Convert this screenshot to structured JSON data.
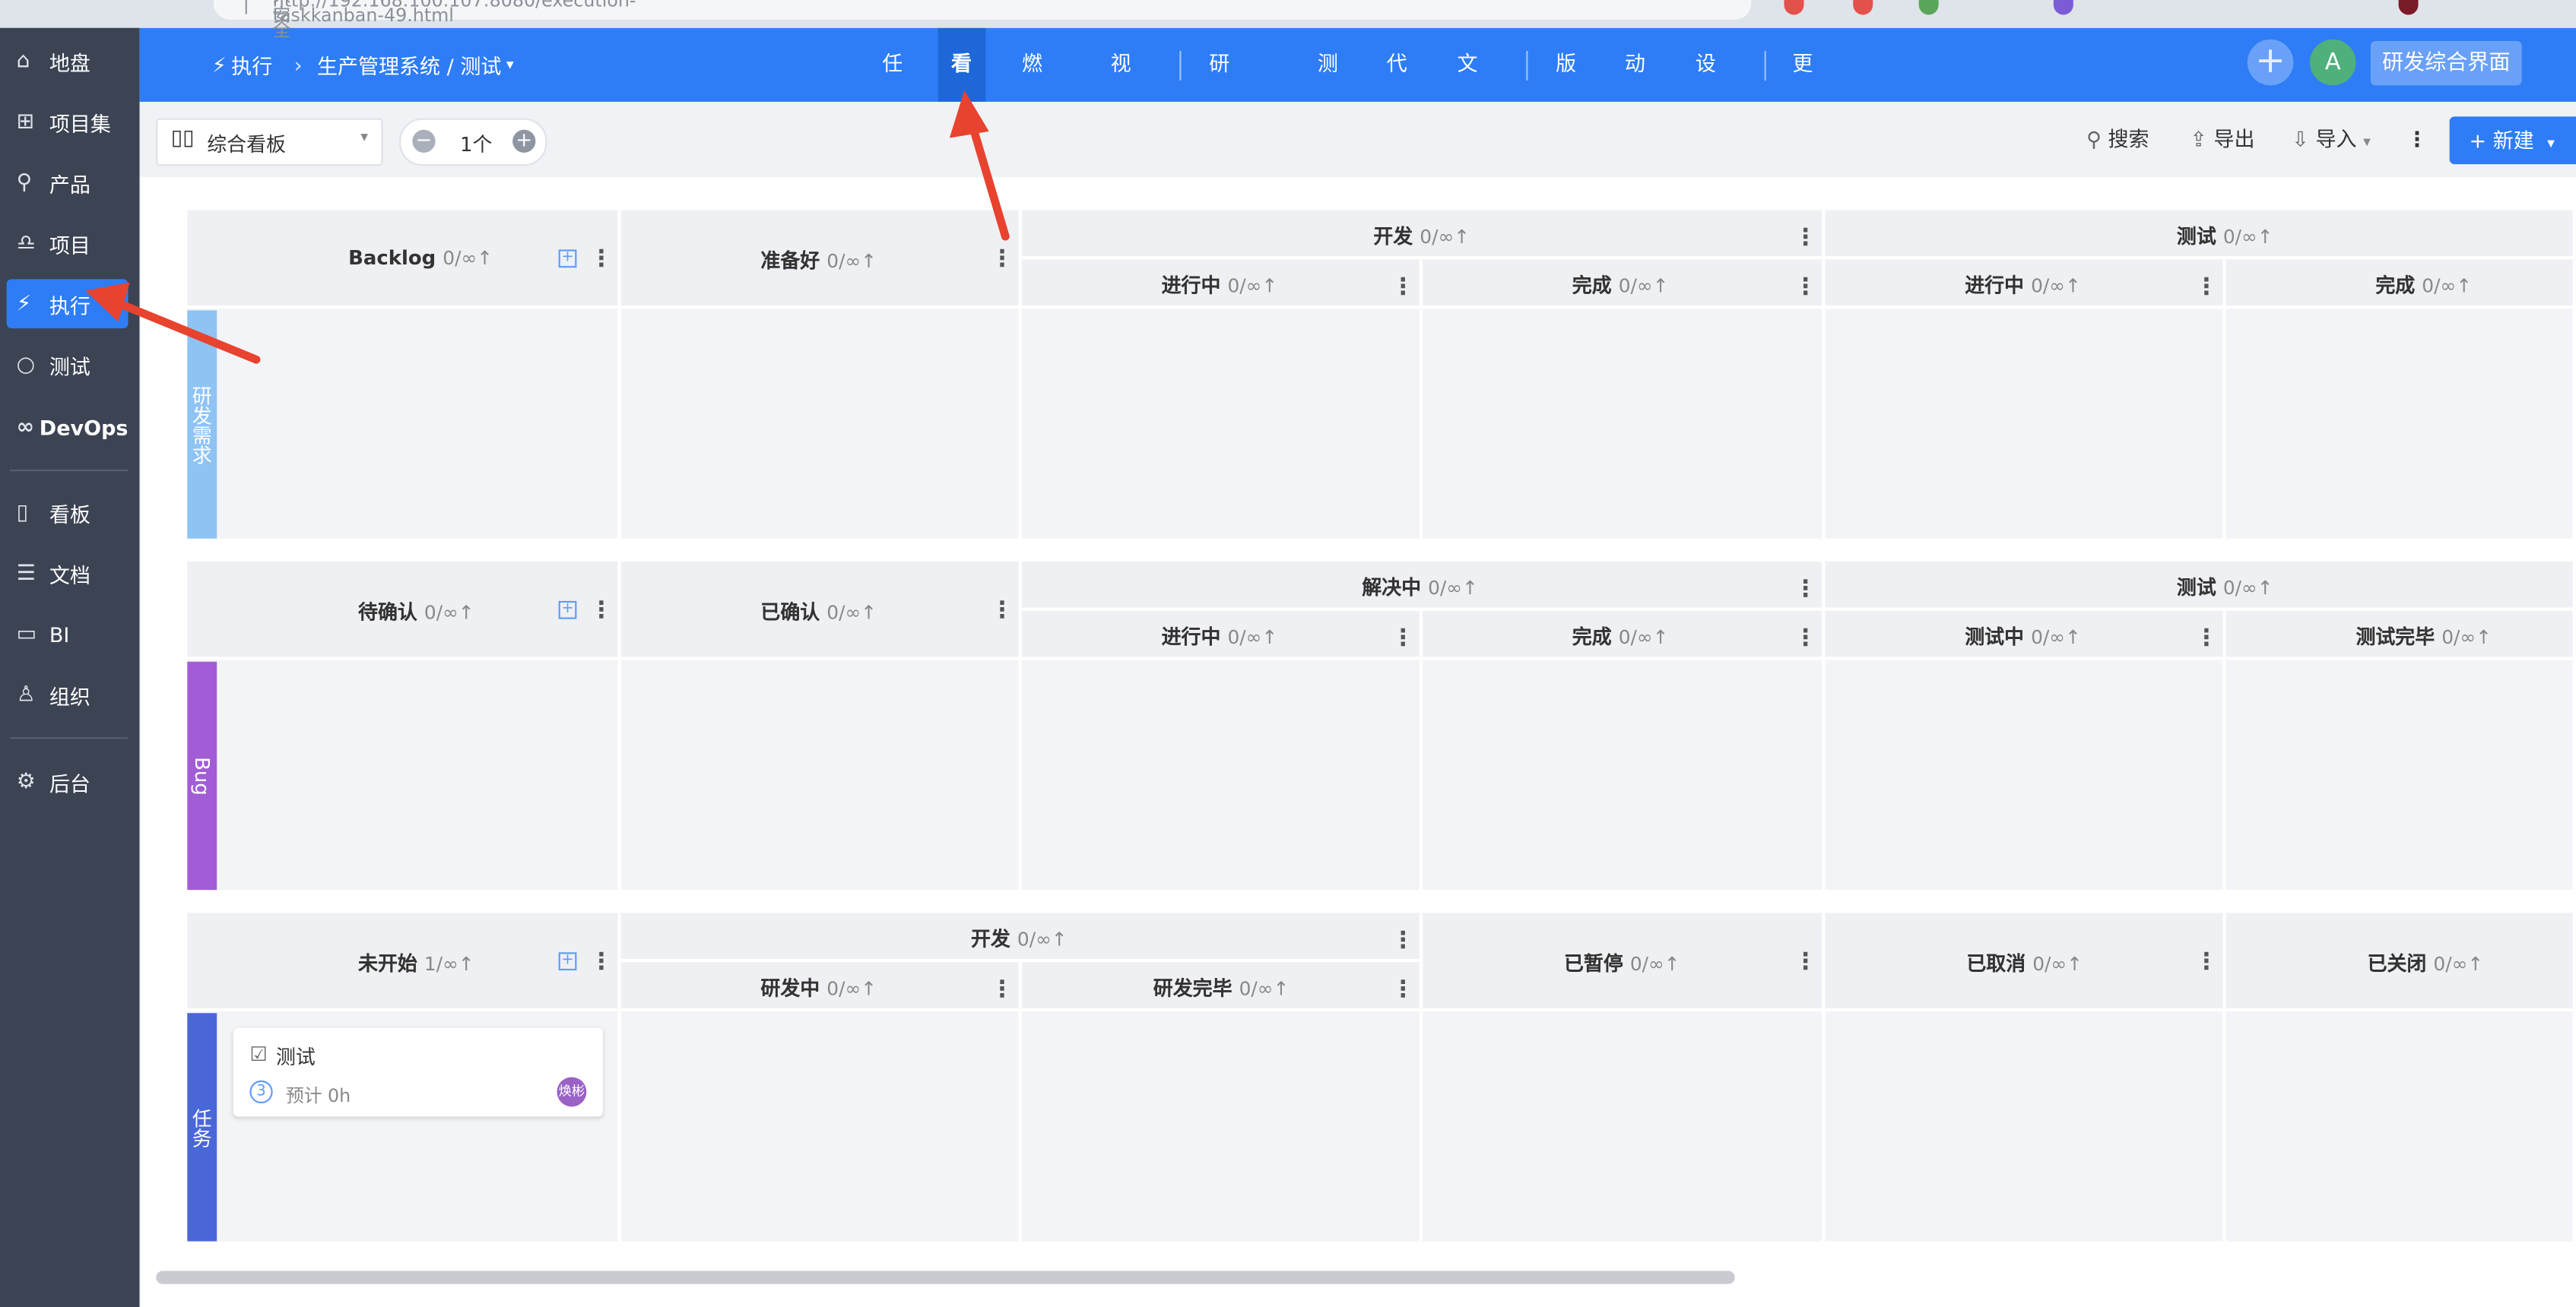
{
  "browser": {
    "url": "http://192.168.100.107:8080/execution-taskkanban-49.html",
    "url_prefix": "不安全"
  },
  "sidebar": {
    "items": [
      {
        "label": "地盘",
        "icon": "home-icon"
      },
      {
        "label": "项目集",
        "icon": "grid-icon"
      },
      {
        "label": "产品",
        "icon": "bulb-icon"
      },
      {
        "label": "项目",
        "icon": "bell-icon"
      },
      {
        "label": "执行",
        "icon": "run-icon",
        "active": true
      },
      {
        "label": "测试",
        "icon": "search-icon"
      },
      {
        "label": "DevOps",
        "icon": "infinity-icon"
      },
      {
        "label": "看板",
        "icon": "kanban-icon"
      },
      {
        "label": "文档",
        "icon": "doc-icon"
      },
      {
        "label": "BI",
        "icon": "monitor-icon"
      },
      {
        "label": "组织",
        "icon": "user-icon"
      },
      {
        "label": "后台",
        "icon": "gear-icon"
      }
    ]
  },
  "header": {
    "breadcrumb": {
      "module": "执行",
      "path": "生产管理系统 / 测试"
    },
    "nav": [
      {
        "label": "任务"
      },
      {
        "label": "看板",
        "active": true
      },
      {
        "label": "燃尽图"
      },
      {
        "label": "视图"
      },
      {
        "label": "研发需求"
      },
      {
        "label": "测试"
      },
      {
        "label": "代码"
      },
      {
        "label": "文档"
      },
      {
        "label": "版本"
      },
      {
        "label": "动态"
      },
      {
        "label": "设置"
      },
      {
        "label": "更多"
      }
    ],
    "avatar_letter": "A",
    "ui_switch": "研发综合界面"
  },
  "toolbar": {
    "board_type": "综合看板",
    "stepper_value": "1个",
    "search": "搜索",
    "export": "导出",
    "import": "导入",
    "new": "新建"
  },
  "lanes": {
    "story": {
      "label": "研发需求",
      "color": "#8fc3f4",
      "backlog": {
        "name": "Backlog",
        "count": "0/∞↑"
      },
      "ready": {
        "name": "准备好",
        "count": "0/∞↑"
      },
      "dev": {
        "name": "开发",
        "count": "0/∞↑",
        "doing": {
          "name": "进行中",
          "count": "0/∞↑"
        },
        "done": {
          "name": "完成",
          "count": "0/∞↑"
        }
      },
      "test": {
        "name": "测试",
        "count": "0/∞↑",
        "doing": {
          "name": "进行中",
          "count": "0/∞↑"
        },
        "done": {
          "name": "完成",
          "count": "0/∞↑"
        }
      }
    },
    "bug": {
      "label": "Bug",
      "color": "#a25dd6",
      "unconfirmed": {
        "name": "待确认",
        "count": "0/∞↑"
      },
      "confirmed": {
        "name": "已确认",
        "count": "0/∞↑"
      },
      "resolving": {
        "name": "解决中",
        "count": "0/∞↑",
        "doing": {
          "name": "进行中",
          "count": "0/∞↑"
        },
        "done": {
          "name": "完成",
          "count": "0/∞↑"
        }
      },
      "test": {
        "name": "测试",
        "count": "0/∞↑",
        "doing": {
          "name": "测试中",
          "count": "0/∞↑"
        },
        "done": {
          "name": "测试完毕",
          "count": "0/∞↑"
        }
      }
    },
    "task": {
      "label": "任务",
      "color": "#4a67d8",
      "wait": {
        "name": "未开始",
        "count": "1/∞↑"
      },
      "dev": {
        "name": "开发",
        "count": "0/∞↑",
        "doing": {
          "name": "研发中",
          "count": "0/∞↑"
        },
        "done": {
          "name": "研发完毕",
          "count": "0/∞↑"
        }
      },
      "pause": {
        "name": "已暂停",
        "count": "0/∞↑"
      },
      "cancel": {
        "name": "已取消",
        "count": "0/∞↑"
      },
      "closed": {
        "name": "已关闭",
        "count": "0/∞↑"
      },
      "card": {
        "title": "测试",
        "priority": "3",
        "estimate": "预计 0h",
        "assignee": "焕彬"
      }
    }
  },
  "colors": {
    "primary": "#2e7df6",
    "sidebar_bg": "#3c4353",
    "arrow": "#e8432e"
  }
}
